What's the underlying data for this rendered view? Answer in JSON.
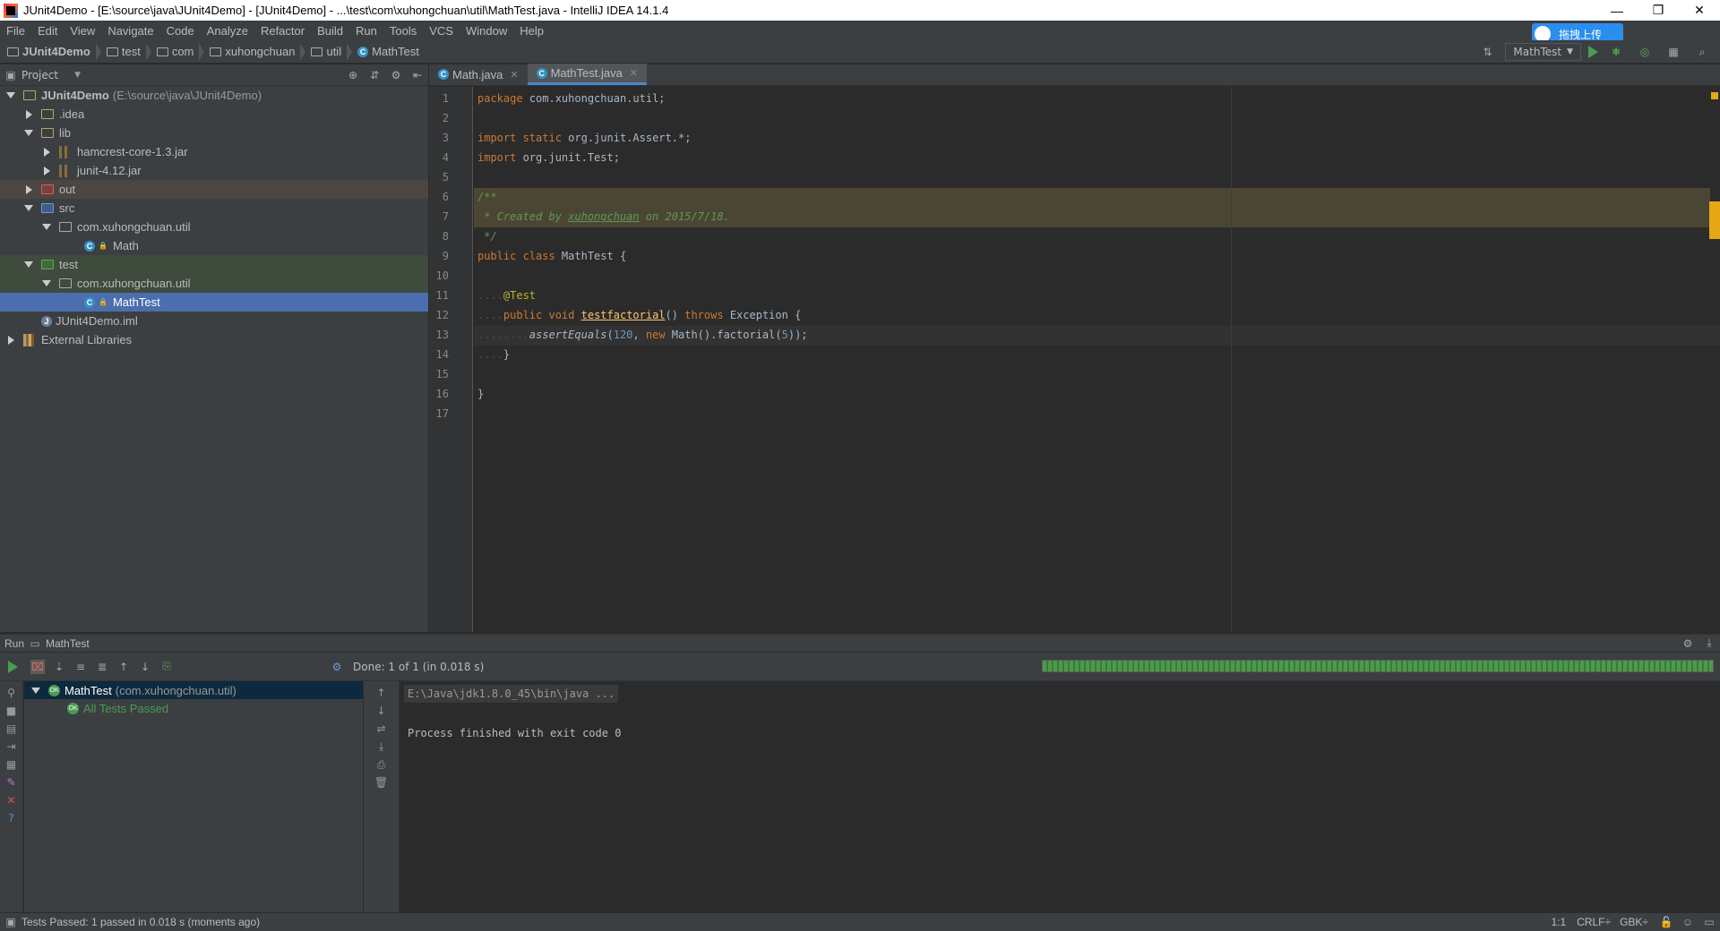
{
  "window": {
    "title": "JUnit4Demo - [E:\\source\\java\\JUnit4Demo] - [JUnit4Demo] - ...\\test\\com\\xuhongchuan\\util\\MathTest.java - IntelliJ IDEA 14.1.4",
    "minimize": "—",
    "restore": "❐",
    "close": "✕"
  },
  "menu": [
    "File",
    "Edit",
    "View",
    "Navigate",
    "Code",
    "Analyze",
    "Refactor",
    "Build",
    "Run",
    "Tools",
    "VCS",
    "Window",
    "Help"
  ],
  "upload_button": "拖拽上传",
  "breadcrumbs": [
    "JUnit4Demo",
    "test",
    "com",
    "xuhongchuan",
    "util",
    "MathTest"
  ],
  "run_config": "MathTest",
  "project_panel": {
    "title": "Project",
    "tree": [
      {
        "label": "JUnit4Demo",
        "extra": "(E:\\source\\java\\JUnit4Demo)",
        "indent": 0,
        "arrow": "down",
        "icon": "module"
      },
      {
        "label": ".idea",
        "indent": 1,
        "arrow": "right",
        "icon": "folder"
      },
      {
        "label": "lib",
        "indent": 1,
        "arrow": "down",
        "icon": "folder"
      },
      {
        "label": "hamcrest-core-1.3.jar",
        "indent": 2,
        "arrow": "right",
        "icon": "jar"
      },
      {
        "label": "junit-4.12.jar",
        "indent": 2,
        "arrow": "right",
        "icon": "jar"
      },
      {
        "label": "out",
        "indent": 1,
        "arrow": "right",
        "icon": "folder-red",
        "state": "out"
      },
      {
        "label": "src",
        "indent": 1,
        "arrow": "down",
        "icon": "folder-blue"
      },
      {
        "label": "com.xuhongchuan.util",
        "indent": 2,
        "arrow": "down",
        "icon": "package"
      },
      {
        "label": "Math",
        "indent": 3,
        "arrow": "none",
        "icon": "class"
      },
      {
        "label": "test",
        "indent": 1,
        "arrow": "down",
        "icon": "folder-green",
        "state": "grn"
      },
      {
        "label": "com.xuhongchuan.util",
        "indent": 2,
        "arrow": "down",
        "icon": "package",
        "state": "grn"
      },
      {
        "label": "MathTest",
        "indent": 3,
        "arrow": "none",
        "icon": "class",
        "state": "sel"
      },
      {
        "label": "JUnit4Demo.iml",
        "indent": 1,
        "arrow": "none",
        "icon": "iml"
      },
      {
        "label": "External Libraries",
        "indent": 0,
        "arrow": "right",
        "icon": "libs"
      }
    ]
  },
  "editor_tabs": [
    {
      "label": "Math.java",
      "active": false
    },
    {
      "label": "MathTest.java",
      "active": true
    }
  ],
  "code_lines": [
    "<span class='kw'>package</span> com.xuhongchuan.util;",
    "",
    "<span class='kw'>import static</span> org.junit.Assert.*;",
    "<span class='kw'>import</span> org.junit.Test;",
    "",
    "<span class='doc'>/**</span>",
    "<span class='doc'> * Created by <u>xuhongchuan</u> on 2015/7/18.</span>",
    "<span class='doc'> */</span>",
    "<span class='kw'>public class</span> MathTest {",
    "",
    "<span class='dot'>....</span><span class='ann'>@Test</span>",
    "<span class='dot'>....</span><span class='kw'>public void</span> <span class='fn'><u>testfactorial</u></span>() <span class='kw'>throws</span> Exception {",
    "<span class='dot'>........</span><span class='it'>assertEquals</span>(<span class='num'>120</span>, <span class='kw'>new</span> Math().factorial(<span class='num'>5</span>));",
    "<span class='dot'>....</span>}",
    "",
    "}",
    ""
  ],
  "run_panel": {
    "title": "Run",
    "config": "MathTest",
    "status": "Done: 1 of 1 (in 0.018 s)",
    "progress": 1.0,
    "test_tree": [
      {
        "label": "MathTest",
        "extra": "(com.xuhongchuan.util)"
      },
      {
        "label": "All Tests Passed"
      }
    ],
    "console": [
      "E:\\Java\\jdk1.8.0_45\\bin\\java ...",
      "",
      "Process finished with exit code 0"
    ]
  },
  "statusbar": {
    "message": "Tests Passed: 1 passed in 0.018 s (moments ago)",
    "position": "1:1",
    "line_sep": "CRLF÷",
    "encoding": "GBK÷"
  }
}
